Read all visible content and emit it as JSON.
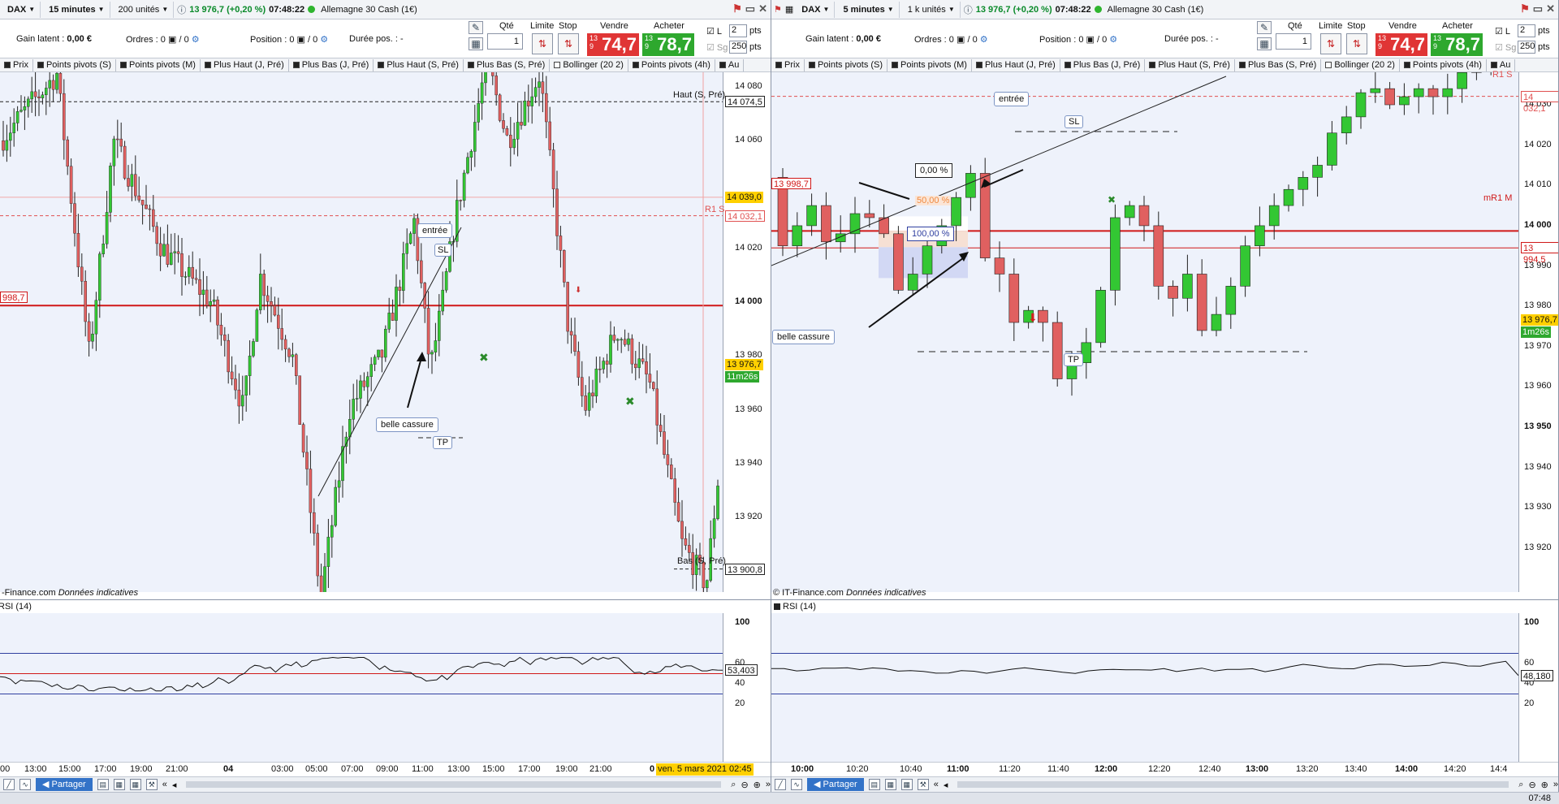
{
  "left": {
    "instrument": "DAX",
    "timeframe": "15 minutes",
    "units": "200 unités",
    "quote": "13 976,7 (+0,20 %)",
    "time": "07:48:22",
    "name": "Allemagne 30 Cash (1€)",
    "gain_label": "Gain latent :",
    "gain_value": "0,00 €",
    "orders_label": "Ordres :",
    "orders_value": "0",
    "orders_value2": "/ 0",
    "position_label": "Position :",
    "position_value": "0",
    "position_value2": "/ 0",
    "duree_label": "Durée pos. :",
    "duree_value": "-",
    "qty_label": "Qté",
    "qty_value": "1",
    "limit_label": "Limite",
    "stop_label": "Stop",
    "sell_label": "Vendre",
    "sell_small": "13 9",
    "sell_big": "74,7",
    "buy_label": "Acheter",
    "buy_small": "13 9",
    "buy_big": "78,7",
    "chk_l": "L",
    "chk_sg": "Sg",
    "pts1": "2",
    "pts_unit1": "pts",
    "pts2": "250",
    "pts_unit2": "pts",
    "indicators": [
      "Prix",
      "Points pivots (S)",
      "Points pivots (M)",
      "Plus Haut (J, Pré)",
      "Plus Bas (J, Pré)",
      "Plus Haut (S, Pré)",
      "Plus Bas (S, Pré)",
      "Bollinger (20 2)",
      "Points pivots (4h)",
      "Au"
    ],
    "y_labels": [
      "14 080",
      "14 060",
      "14 020",
      "14 000",
      "13 980",
      "13 960",
      "13 940",
      "13 920"
    ],
    "tag_haut": "14 074,5",
    "tag_haut_text": "Haut (S, Pré)",
    "tag_bol": "14 039,0",
    "tag_r1": "14 032,1",
    "tag_r1_text": "R1 S",
    "tag_price": "13 976,7",
    "tag_timer": "11m26s",
    "tag_low": "13 900,8",
    "tag_998": "998,7",
    "bas_text": "Bas (S, Pré)",
    "credit": "-Finance.com",
    "credit_i": "Données indicatives",
    "rsi_label": "RSI (14)",
    "rsi_y": [
      "100",
      "60",
      "40",
      "20"
    ],
    "rsi_val": "53,403",
    "x_labels": [
      "00",
      "13:00",
      "15:00",
      "17:00",
      "19:00",
      "21:00",
      "04",
      "03:00",
      "05:00",
      "07:00",
      "09:00",
      "11:00",
      "13:00",
      "15:00",
      "17:00",
      "19:00",
      "21:00",
      "0"
    ],
    "x_cursor": "ven. 5 mars 2021 02:45",
    "share": "Partager",
    "annot_entree": "entrée",
    "annot_sl": "SL",
    "annot_tp": "TP",
    "annot_cassure": "belle cassure"
  },
  "right": {
    "instrument": "DAX",
    "timeframe": "5 minutes",
    "units": "1 k unités",
    "quote": "13 976,7 (+0,20 %)",
    "time": "07:48:22",
    "name": "Allemagne 30 Cash (1€)",
    "gain_label": "Gain latent :",
    "gain_value": "0,00 €",
    "orders_label": "Ordres :",
    "orders_value": "0",
    "orders_value2": "/ 0",
    "position_label": "Position :",
    "position_value": "0",
    "position_value2": "/ 0",
    "duree_label": "Durée pos. :",
    "duree_value": "-",
    "qty_label": "Qté",
    "qty_value": "1",
    "limit_label": "Limite",
    "stop_label": "Stop",
    "sell_label": "Vendre",
    "sell_small": "13 9",
    "sell_big": "74,7",
    "buy_label": "Acheter",
    "buy_small": "13 9",
    "buy_big": "78,7",
    "chk_l": "L",
    "chk_sg": "Sg",
    "pts1": "2",
    "pts_unit1": "pts",
    "pts2": "250",
    "pts_unit2": "pts",
    "indicators": [
      "Prix",
      "Points pivots (S)",
      "Points pivots (M)",
      "Plus Haut (J, Pré)",
      "Plus Bas (J, Pré)",
      "Plus Haut (S, Pré)",
      "Plus Bas (S, Pré)",
      "Bollinger (20 2)",
      "Points pivots (4h)",
      "Au"
    ],
    "y_labels": [
      "14 030",
      "14 020",
      "14 010",
      "14 000",
      "13 990",
      "13 980",
      "13 970",
      "13 960",
      "13 950",
      "13 940",
      "13 930",
      "13 920"
    ],
    "tag_r1": "14 032,1",
    "tag_r1_text": "R1 S",
    "tag_mr1": "13 994,5",
    "tag_mr1_text": "mR1 M",
    "tag_price": "13 976,7",
    "tag_timer": "1m26s",
    "tag_998": "13 998,7",
    "credit": "© IT-Finance.com",
    "credit_i": "Données indicatives",
    "rsi_label": "RSI (14)",
    "rsi_y": [
      "100",
      "60",
      "40",
      "20"
    ],
    "rsi_val": "48,180",
    "x_labels": [
      "10:00",
      "10:20",
      "10:40",
      "11:00",
      "11:20",
      "11:40",
      "12:00",
      "12:20",
      "12:40",
      "13:00",
      "13:20",
      "13:40",
      "14:00",
      "14:20",
      "14:4"
    ],
    "share": "Partager",
    "annot_entree": "entrée",
    "annot_sl": "SL",
    "annot_tp": "TP",
    "annot_cassure": "belle cassure",
    "fib0": "0,00 %",
    "fib50": "50,00 %",
    "fib100": "100,00 %"
  },
  "clock": "07:48",
  "colors": {
    "bull": "#33c733",
    "bear": "#e06060",
    "sell": "#e03535",
    "buy": "#2ea82e",
    "accent": "#3373c8"
  },
  "icons": [
    "trade-icon",
    "settings-icon",
    "close-icon",
    "minimize-icon",
    "zoom-in-icon",
    "zoom-out-icon",
    "share-icon"
  ]
}
